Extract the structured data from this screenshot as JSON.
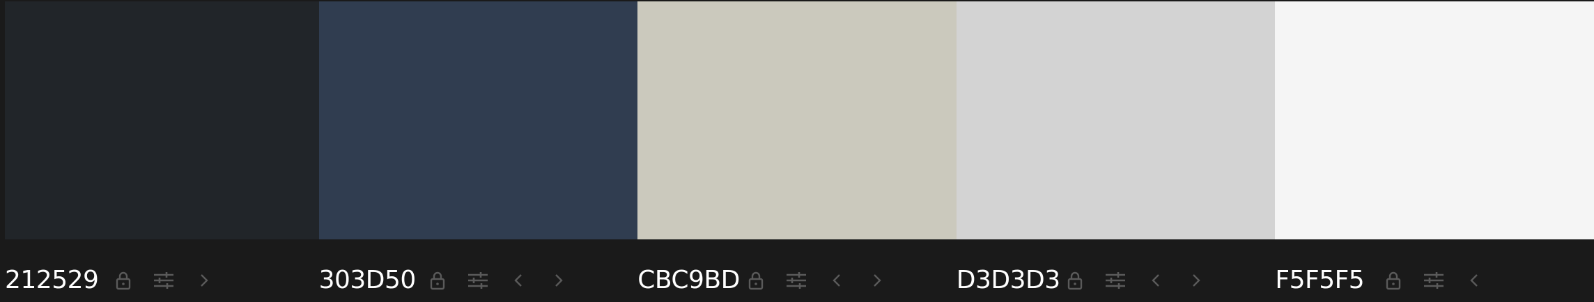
{
  "colors": {
    "background": "#1A1A1A",
    "icon": "#5A5A5A",
    "text": "#FFFFFF"
  },
  "swatches": [
    {
      "hex": "212529",
      "color": "#212529",
      "icons": [
        "lock-icon",
        "adjust-icon",
        "chevron-right-icon"
      ]
    },
    {
      "hex": "303D50",
      "color": "#303D50",
      "icons": [
        "lock-icon",
        "adjust-icon",
        "chevron-left-icon",
        "chevron-right-icon"
      ]
    },
    {
      "hex": "CBC9BD",
      "color": "#CBC9BD",
      "icons": [
        "lock-icon",
        "adjust-icon",
        "chevron-left-icon",
        "chevron-right-icon"
      ]
    },
    {
      "hex": "D3D3D3",
      "color": "#D3D3D3",
      "icons": [
        "lock-icon",
        "adjust-icon",
        "chevron-left-icon",
        "chevron-right-icon"
      ]
    },
    {
      "hex": "F5F5F5",
      "color": "#F5F5F5",
      "icons": [
        "lock-icon",
        "adjust-icon",
        "chevron-left-icon"
      ]
    }
  ]
}
